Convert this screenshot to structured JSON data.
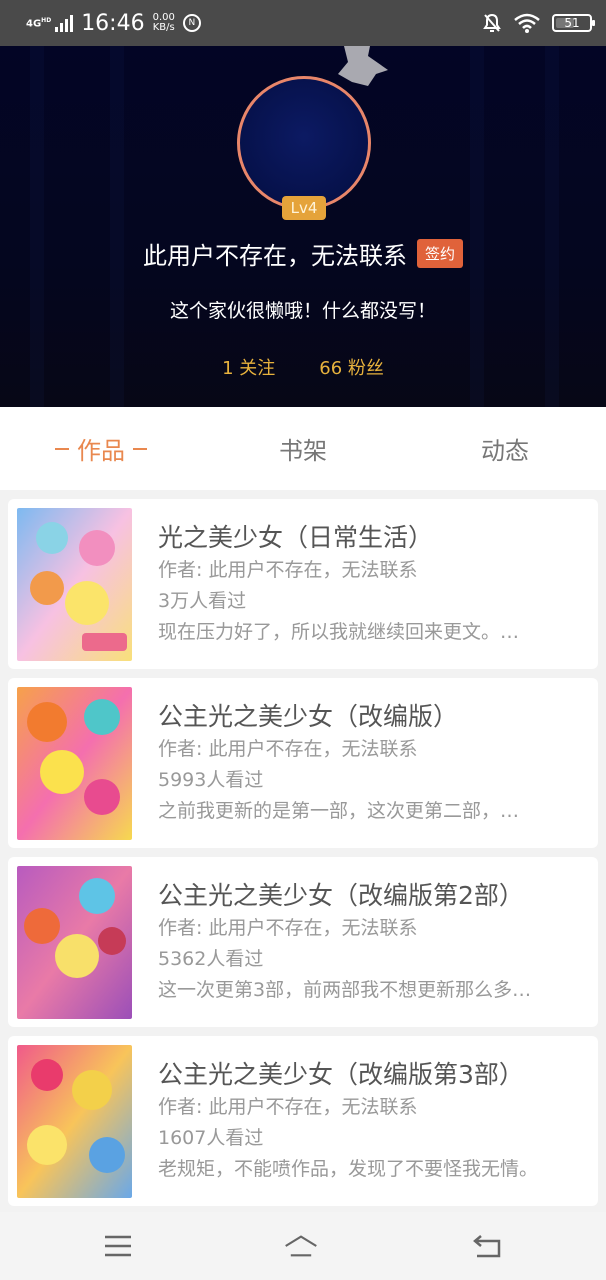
{
  "status_bar": {
    "network": "4G",
    "network_sup": "HD",
    "time": "16:46",
    "speed_value": "0.00",
    "speed_unit": "KB/s",
    "battery": "51",
    "icons": [
      "signal-icon",
      "nfc-icon",
      "mute-bell-icon",
      "wifi-icon",
      "battery-icon"
    ]
  },
  "profile": {
    "level": "Lv4",
    "username": "此用户不存在，无法联系",
    "sign_badge": "签约",
    "bio": "这个家伙很懒哦！什么都没写！",
    "following": "1 关注",
    "fans": "66 粉丝"
  },
  "tabs": [
    {
      "label": "作品",
      "active": true
    },
    {
      "label": "书架",
      "active": false
    },
    {
      "label": "动态",
      "active": false
    }
  ],
  "works": [
    {
      "title": "光之美少女（日常生活）",
      "author": "作者: 此用户不存在，无法联系",
      "views": "3万人看过",
      "desc": "现在压力好了，所以我就继续回来更文。…"
    },
    {
      "title": "公主光之美少女（改编版）",
      "author": "作者: 此用户不存在，无法联系",
      "views": "5993人看过",
      "desc": "之前我更新的是第一部，这次更第二部，…"
    },
    {
      "title": "公主光之美少女（改编版第2部）",
      "author": "作者: 此用户不存在，无法联系",
      "views": "5362人看过",
      "desc": "这一次更第3部，前两部我不想更新那么多…"
    },
    {
      "title": "公主光之美少女（改编版第3部）",
      "author": "作者: 此用户不存在，无法联系",
      "views": "1607人看过",
      "desc": "老规矩，不能喷作品，发现了不要怪我无情。"
    }
  ],
  "colors": {
    "accent": "#e9884f",
    "badge_orange": "#e0623a",
    "level_badge": "#e5a33a",
    "stats_gold": "#e7b23d",
    "header_bg": "#030525"
  }
}
